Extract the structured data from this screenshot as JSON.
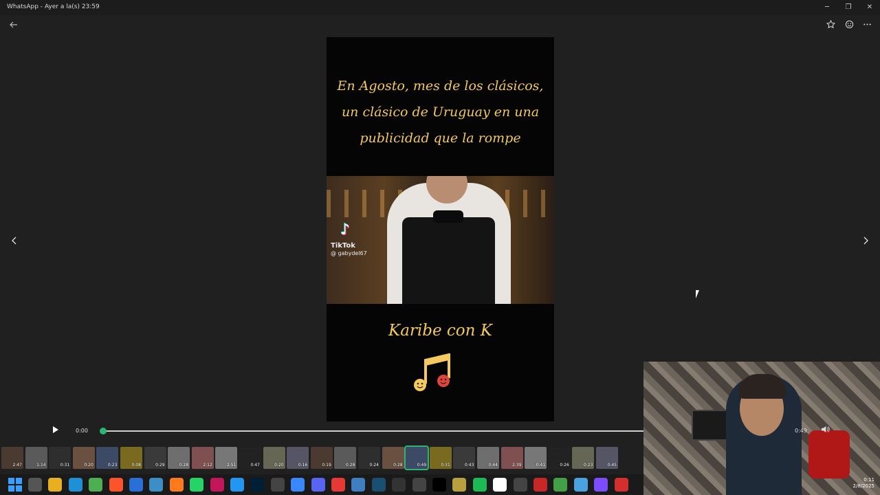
{
  "window": {
    "title": "WhatsApp - Ayer a la(s) 23:59",
    "minimize_glyph": "─",
    "restore_glyph": "❐",
    "close_glyph": "✕"
  },
  "toolbar": {
    "back_icon": "arrow-left-icon",
    "star_icon": "star-icon",
    "emoji_icon": "smiley-icon",
    "more_icon": "more-horizontal-icon"
  },
  "video": {
    "caption_top": [
      "En Agosto, mes de los clásicos,",
      "un clásico de Uruguay en una",
      "publicidad que la rompe"
    ],
    "caption_bottom": "Karibe con K",
    "watermark_brand": "TikTok",
    "watermark_user": "@ gabydel67"
  },
  "player": {
    "current_time": "0:00",
    "total_time": "0:49",
    "progress": 0.0
  },
  "thumbnails": [
    {
      "dur": "2:47"
    },
    {
      "dur": "1:14"
    },
    {
      "dur": "0:31"
    },
    {
      "dur": "0:20"
    },
    {
      "dur": "0:23"
    },
    {
      "dur": "0:08"
    },
    {
      "dur": "0:29"
    },
    {
      "dur": "0:28"
    },
    {
      "dur": "2:12"
    },
    {
      "dur": "2:51"
    },
    {
      "dur": "0:47"
    },
    {
      "dur": "0:20"
    },
    {
      "dur": "0:16"
    },
    {
      "dur": "0:19"
    },
    {
      "dur": "0:28"
    },
    {
      "dur": "0:24"
    },
    {
      "dur": "0:28"
    },
    {
      "dur": "0:49",
      "active": true
    },
    {
      "dur": "0:31"
    },
    {
      "dur": "0:43"
    },
    {
      "dur": "0:44"
    },
    {
      "dur": "2:39"
    },
    {
      "dur": "0:41"
    },
    {
      "dur": "0:26"
    },
    {
      "dur": "0:23"
    },
    {
      "dur": "0:45"
    }
  ],
  "webcam_clock": {
    "time": "0:11",
    "date": "2/8/2025"
  },
  "taskbar_icons": [
    "search-icon",
    "file-explorer-icon",
    "edge-icon",
    "chrome-icon",
    "brave-icon",
    "browser-icon",
    "chrome-alt-icon",
    "firefox-icon",
    "whatsapp-icon",
    "app-icon",
    "app-icon",
    "photoshop-icon",
    "app-icon",
    "app-icon",
    "discord-icon",
    "app-icon",
    "app-icon",
    "app-icon",
    "app-icon",
    "app-icon",
    "tiktok-icon",
    "app-icon",
    "spotify-icon",
    "app-icon",
    "app-icon",
    "app-icon",
    "app-icon",
    "app-icon",
    "app-icon",
    "app-icon"
  ],
  "colors": {
    "accent_green": "#2bb673",
    "caption_gold": "#f4c95d"
  }
}
